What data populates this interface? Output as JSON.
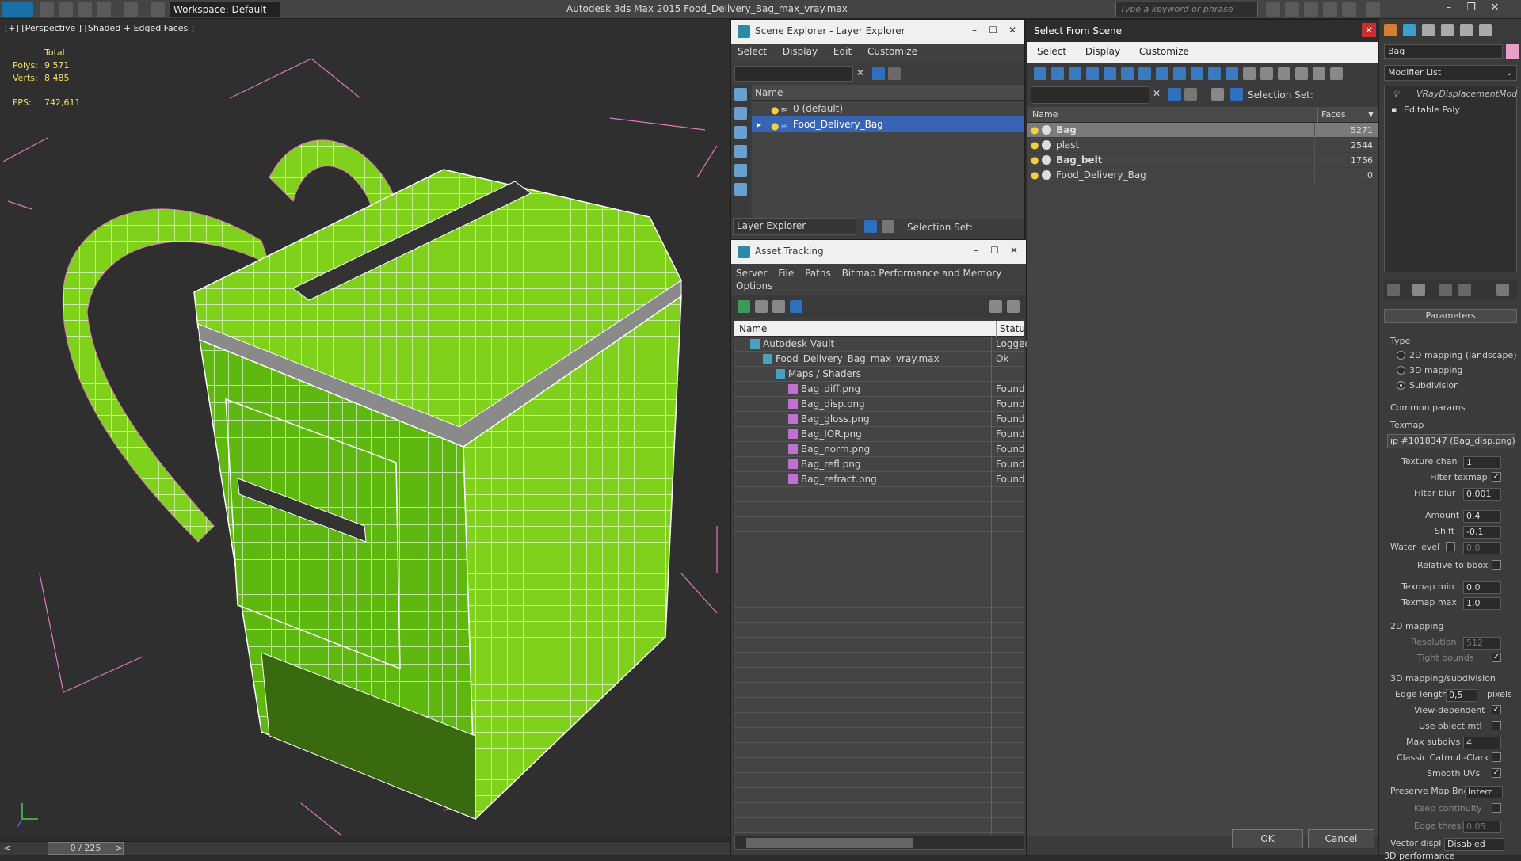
{
  "app": {
    "title": "Autodesk 3ds Max  2015    Food_Delivery_Bag_max_vray.max",
    "workspace": "Workspace: Default",
    "search_placeholder": "Type a keyword or phrase"
  },
  "viewport": {
    "label": "[+] [Perspective ] [Shaded + Edged Faces ]",
    "stats": {
      "total": "Total",
      "polys_label": "Polys:",
      "polys": "9 571",
      "verts_label": "Verts:",
      "verts": "8 485",
      "fps_label": "FPS:",
      "fps": "742,611"
    },
    "timeline": "0 / 225"
  },
  "scene_explorer": {
    "title": "Scene Explorer - Layer Explorer",
    "menu": [
      "Select",
      "Display",
      "Edit",
      "Customize"
    ],
    "column": "Name",
    "rows": [
      {
        "label": "0 (default)"
      },
      {
        "label": "Food_Delivery_Bag"
      }
    ],
    "footer_left": "Layer Explorer",
    "footer_right": "Selection Set:"
  },
  "asset_tracking": {
    "title": "Asset Tracking",
    "menu": [
      "Server",
      "File",
      "Paths",
      "Bitmap Performance and Memory",
      "Options"
    ],
    "columns": [
      "Name",
      "Status"
    ],
    "rows": [
      {
        "name": "Autodesk Vault",
        "status": "Logged",
        "indent": 0
      },
      {
        "name": "Food_Delivery_Bag_max_vray.max",
        "status": "Ok",
        "indent": 1
      },
      {
        "name": "Maps / Shaders",
        "status": "",
        "indent": 2
      },
      {
        "name": "Bag_diff.png",
        "status": "Found",
        "indent": 3
      },
      {
        "name": "Bag_disp.png",
        "status": "Found",
        "indent": 3
      },
      {
        "name": "Bag_gloss.png",
        "status": "Found",
        "indent": 3
      },
      {
        "name": "Bag_IOR.png",
        "status": "Found",
        "indent": 3
      },
      {
        "name": "Bag_norm.png",
        "status": "Found",
        "indent": 3
      },
      {
        "name": "Bag_refl.png",
        "status": "Found",
        "indent": 3
      },
      {
        "name": "Bag_refract.png",
        "status": "Found",
        "indent": 3
      }
    ]
  },
  "select_from_scene": {
    "title": "Select From Scene",
    "menu": [
      "Select",
      "Display",
      "Customize"
    ],
    "selection_set": "Selection Set:",
    "columns": [
      "Name",
      "Faces"
    ],
    "rows": [
      {
        "name": "Bag",
        "faces": "5271"
      },
      {
        "name": "plast",
        "faces": "2544"
      },
      {
        "name": "Bag_belt",
        "faces": "1756"
      },
      {
        "name": "Food_Delivery_Bag",
        "faces": "0"
      }
    ],
    "ok": "OK",
    "cancel": "Cancel"
  },
  "modify_panel": {
    "object_name": "Bag",
    "modifier_list": "Modifier List",
    "stack": [
      "VRayDisplacementMod",
      "Editable Poly"
    ],
    "rollout": "Parameters",
    "type_label": "Type",
    "type_options": [
      "2D mapping (landscape)",
      "3D mapping",
      "Subdivision"
    ],
    "common_params": "Common params",
    "texmap_label": "Texmap",
    "texmap_value": "ıp #1018347 (Bag_disp.png)",
    "texture_chan_label": "Texture chan",
    "texture_chan": "1",
    "filter_texmap_label": "Filter texmap",
    "filter_blur_label": "Filter blur",
    "filter_blur": "0,001",
    "amount_label": "Amount",
    "amount": "0,4",
    "shift_label": "Shift",
    "shift": "-0,1",
    "water_level_label": "Water level",
    "water_level": "0,0",
    "relative_bbox_label": "Relative to bbox",
    "texmap_min_label": "Texmap min",
    "texmap_min": "0,0",
    "texmap_max_label": "Texmap max",
    "texmap_max": "1,0",
    "mapping2d": "2D mapping",
    "resolution_label": "Resolution",
    "resolution": "512",
    "tight_bounds_label": "Tight bounds",
    "mapping3d": "3D mapping/subdivision",
    "edge_length_label": "Edge length",
    "edge_length": "0,5",
    "pixels_label": "pixels",
    "view_dependent_label": "View-dependent",
    "use_object_mtl_label": "Use object mtl",
    "max_subdivs_label": "Max subdivs",
    "max_subdivs": "4",
    "classic_cc_label": "Classic Catmull-Clark",
    "smooth_uvs_label": "Smooth UVs",
    "preserve_map_label": "Preserve Map Bnd",
    "preserve_map": "Interr",
    "keep_continuity_label": "Keep continuity",
    "edge_thresh_label": "Edge thresh",
    "edge_thresh": "0,05",
    "vector_displ_label": "Vector displ",
    "vector_displ": "Disabled",
    "perf": "3D performance"
  }
}
